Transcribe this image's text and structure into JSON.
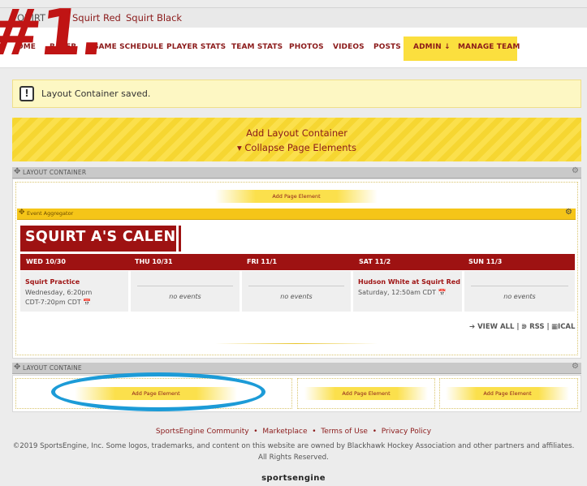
{
  "tabs": [
    "QUIRT",
    "Squirt Red",
    "Squirt Black"
  ],
  "nav": [
    "OME",
    "R",
    "ER",
    "GAME SCHEDULE",
    "PLAYER STATS",
    "TEAM STATS",
    "PHOTOS",
    "VIDEOS",
    "POSTS",
    "ADMIN ↓",
    "MANAGE TEAM"
  ],
  "overlay_mark": "#1.",
  "notice": "Layout Container saved.",
  "addbar": {
    "title": "Add Layout Container",
    "collapse": "▾ Collapse Page Elements"
  },
  "layout_container_label": "LAYOUT CONTAINER",
  "layout_container_label2": "LAYOUT CONTAINE",
  "add_page_element": "Add Page Element",
  "event_aggregator": "Event Aggregator",
  "calendar_title": "SQUIRT A'S CALENDAR",
  "days": [
    "WED 10/30",
    "THU 10/31",
    "FRI 11/1",
    "SAT 11/2",
    "SUN 11/3"
  ],
  "events": {
    "wed_title": "Squirt Practice",
    "wed_line1": "Wednesday, 6:20pm",
    "wed_line2": "CDT-7:20pm CDT",
    "sat_title": "Hudson White at Squirt Red",
    "sat_line1": "Saturday, 12:50am CDT",
    "no_events": "no events"
  },
  "feeds": {
    "view_all": "VIEW ALL",
    "rss": "RSS",
    "ical": "ICAL"
  },
  "footer": {
    "links": [
      "SportsEngine Community",
      "Marketplace",
      "Terms of Use",
      "Privacy Policy"
    ],
    "copyright": "©2019 SportsEngine, Inc. Some logos, trademarks, and content on this website are owned by Blackhawk Hockey Association and other partners and affiliates. All Rights Reserved.",
    "logo": "sportsengine"
  },
  "colors": {
    "brand": "#9e1212",
    "accent": "#f5c518",
    "highlight_ring": "#1c9bd7"
  }
}
